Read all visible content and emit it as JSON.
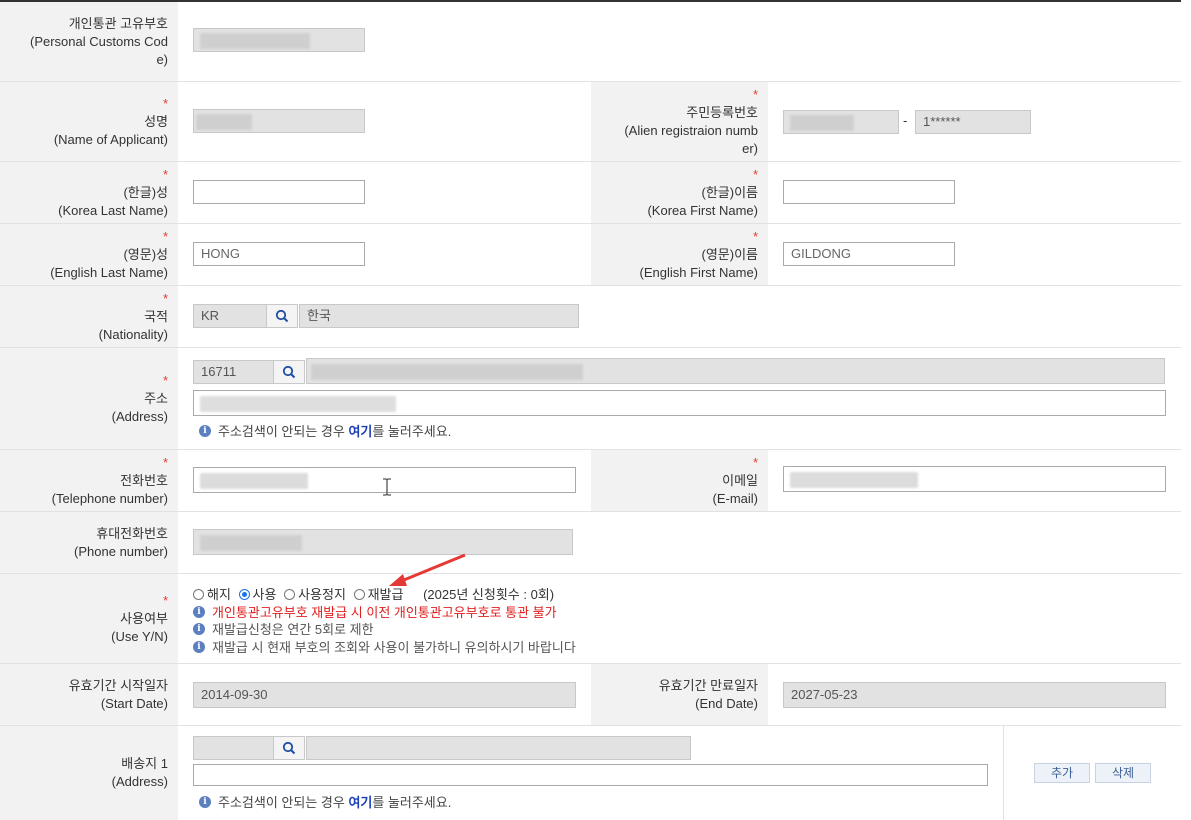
{
  "customs_code": {
    "label_ko": "개인통관 고유부호",
    "label_en1": "(Personal Customs Cod",
    "label_en2": "e)"
  },
  "name": {
    "label_ko": "성명",
    "label_en": "(Name of Applicant)"
  },
  "alien_reg": {
    "label_ko": "주민등록번호",
    "label_en1": "(Alien registraion numb",
    "label_en2": "er)",
    "separator": "-",
    "second_value": "1******"
  },
  "korea_last": {
    "label_ko": "(한글)성",
    "label_en": "(Korea Last Name)",
    "value": ""
  },
  "korea_first": {
    "label_ko": "(한글)이름",
    "label_en": "(Korea First Name)",
    "value": ""
  },
  "eng_last": {
    "label_ko": "(영문)성",
    "label_en": "(English Last Name)",
    "value": "HONG"
  },
  "eng_first": {
    "label_ko": "(영문)이름",
    "label_en": "(English First Name)",
    "value": "GILDONG"
  },
  "nationality": {
    "label_ko": "국적",
    "label_en": "(Nationality)",
    "code": "KR",
    "name": "한국"
  },
  "address": {
    "label_ko": "주소",
    "label_en": "(Address)",
    "zip": "16711",
    "help_prefix": "주소검색이 안되는 경우 ",
    "help_link": "여기",
    "help_suffix": "를 눌러주세요."
  },
  "telephone": {
    "label_ko": "전화번호",
    "label_en": "(Telephone number)"
  },
  "email": {
    "label_ko": "이메일",
    "label_en": "(E-mail)"
  },
  "mobile": {
    "label_ko": "휴대전화번호",
    "label_en": "(Phone number)"
  },
  "use_yn": {
    "label_ko": "사용여부",
    "label_en": "(Use Y/N)",
    "options": [
      "해지",
      "사용",
      "사용정지",
      "재발급"
    ],
    "selected": "사용",
    "count_text": "(2025년 신청횟수 : 0회)",
    "notice_red": "개인통관고유부호 재발급 시 이전 개인통관고유부호로 통관 불가",
    "notice_1": "재발급신청은 연간 5회로 제한",
    "notice_2": "재발급 시 현재 부호의 조회와 사용이 불가하니 유의하시기 바랍니다"
  },
  "start_date": {
    "label_ko": "유효기간 시작일자",
    "label_en": "(Start Date)",
    "value": "2014-09-30"
  },
  "end_date": {
    "label_ko": "유효기간 만료일자",
    "label_en": "(End Date)",
    "value": "2027-05-23"
  },
  "ship_addr": {
    "label_ko": "배송지 1",
    "label_en": "(Address)",
    "help_prefix": "주소검색이 안되는 경우 ",
    "help_link": "여기",
    "help_suffix": "를 눌러주세요.",
    "add_label": "추가",
    "delete_label": "삭제"
  },
  "colors": {
    "required": "#e53935",
    "label_bg": "#f2f2f2",
    "readonly_bg": "#e2e2e2",
    "link": "#1a3fb3",
    "arrow": "#e53935"
  }
}
